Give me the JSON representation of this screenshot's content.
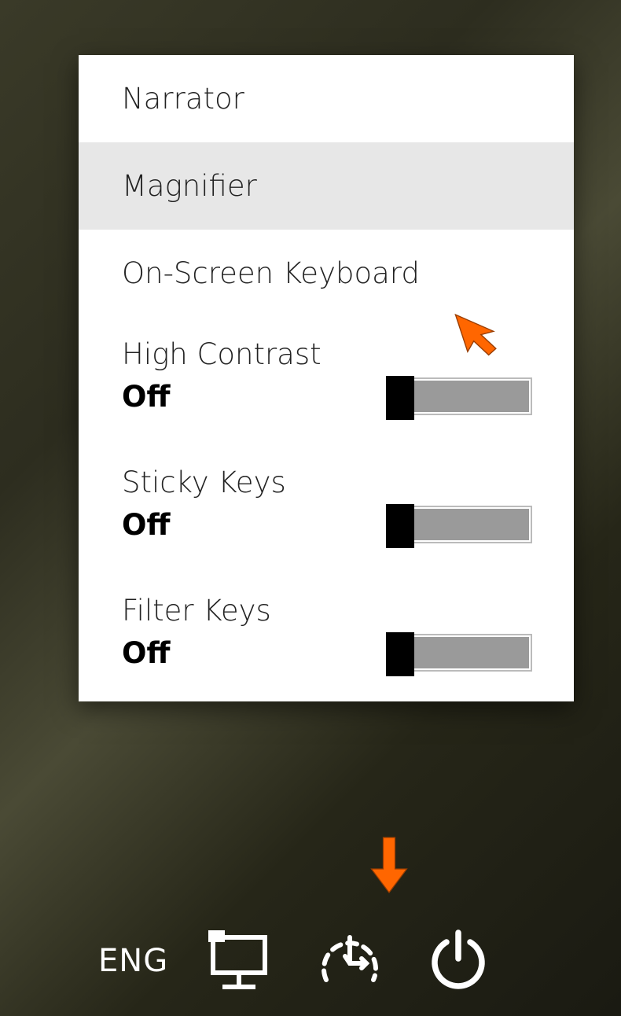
{
  "menu": {
    "narrator": "Narrator",
    "magnifier": "Magnifier",
    "osk": "On-Screen Keyboard",
    "high_contrast": {
      "label": "High Contrast",
      "state": "Off"
    },
    "sticky_keys": {
      "label": "Sticky Keys",
      "state": "Off"
    },
    "filter_keys": {
      "label": "Filter Keys",
      "state": "Off"
    }
  },
  "bottom": {
    "language": "ENG"
  },
  "annotations": {
    "cursor1": {
      "at": "On-Screen Keyboard item"
    },
    "cursor2": {
      "at": "Ease of Access icon"
    }
  }
}
